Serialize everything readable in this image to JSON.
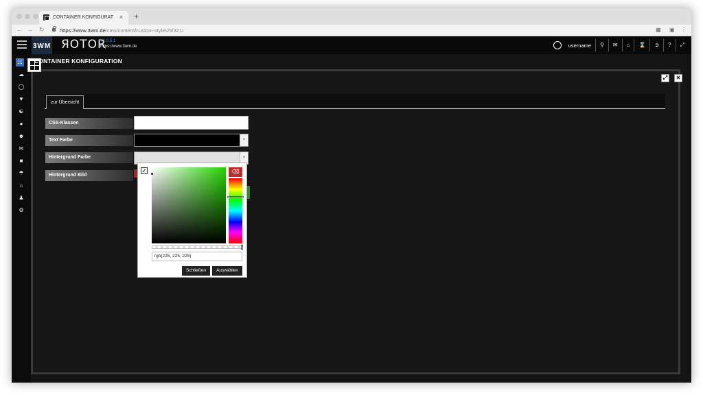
{
  "browser": {
    "tab_title": "CONTAINER KONFIGURATION",
    "tab_close": "×",
    "new_tab": "+",
    "url_host": "https://www.3wm.de",
    "url_path": "/cms/content/custom-styles/5/321/"
  },
  "header": {
    "logo": "3WM",
    "brand": "ЯOTOR",
    "version": "V1.0.5.1",
    "brand_url": "https://www.3wm.de",
    "username": "username",
    "icons": [
      "search-icon",
      "comments-icon",
      "home-icon",
      "spinner-icon",
      "logout-icon",
      "help-icon",
      "expand-icon"
    ]
  },
  "sidebar": {
    "icons": [
      "sitemap-icon",
      "cloud-icon",
      "globe-icon",
      "trophy-icon",
      "restaurant-icon",
      "map-marker-icon",
      "users-icon",
      "envelope-icon",
      "archive-icon",
      "cart-icon",
      "home-icon",
      "user-icon",
      "cogs-icon"
    ],
    "active_index": 0
  },
  "panel": {
    "title": "CONTAINER KONFIGURATION",
    "tab_label": "zur Übersicht"
  },
  "form": {
    "css_label": "CSS-Klassen",
    "css_value": "",
    "text_color_label": "Text Farbe",
    "text_color_value": "#000000",
    "bg_color_label": "Hintergrund Farbe",
    "bg_color_value": "#e1e1e1",
    "bg_image_label": "Hintergrund Bild"
  },
  "colorpicker": {
    "value": "rgb(225, 225, 225)",
    "close_label": "Schließen",
    "choose_label": "Auswählen",
    "hue_color": "#25d400"
  }
}
